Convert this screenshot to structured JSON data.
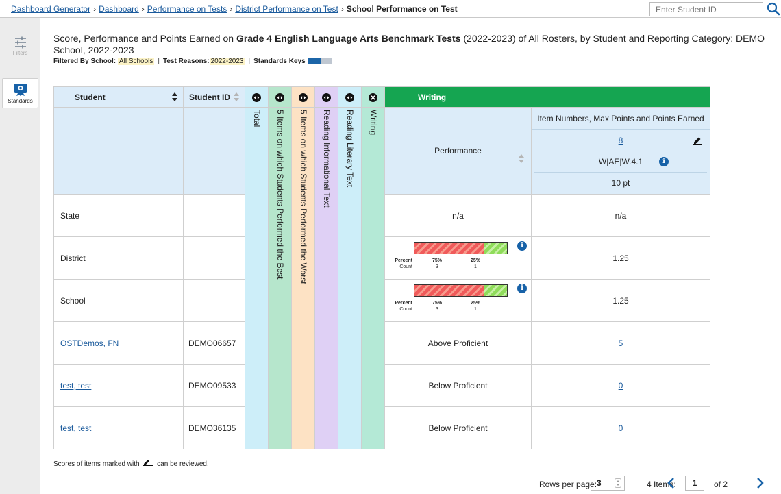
{
  "breadcrumb": [
    {
      "label": "Dashboard Generator"
    },
    {
      "label": "Dashboard"
    },
    {
      "label": "Performance on Tests"
    },
    {
      "label": "District Performance on Test"
    }
  ],
  "breadcrumb_current": "School Performance on Test",
  "student_search": {
    "placeholder": "Enter Student ID"
  },
  "sidebar": {
    "filters_label": "Filters",
    "standards_label": "Standards"
  },
  "description": {
    "prefix": "Score, Performance and Points Earned on ",
    "bold": "Grade 4 English Language Arts Benchmark Tests",
    "suffix": " (2022-2023) of All Rosters, by Student and Reporting Category: DEMO School, 2022-2023"
  },
  "filters": {
    "label": "Filtered By",
    "school_key": "School:",
    "school_value": "All Schools",
    "reasons_key": "Test Reasons:",
    "reasons_value": "2022-2023",
    "keys_label": "Standards Keys"
  },
  "table": {
    "col_student": "Student",
    "col_student_id": "Student ID",
    "vertical_cols": [
      {
        "label": "Total",
        "color": "#cdeef9"
      },
      {
        "label": "5 Items on which Students Performed the Best",
        "color": "#b6e6cc"
      },
      {
        "label": "5 Items on which Students Performed the Worst",
        "color": "#fde2c4"
      },
      {
        "label": "Reading Informational Text",
        "color": "#dfd0f5"
      },
      {
        "label": "Reading Literary Text",
        "color": "#cdeef9"
      },
      {
        "label": "Writing",
        "color": "#b4e9d6"
      }
    ],
    "writing_header": "Writing",
    "performance_header": "Performance",
    "items_header": "Item Numbers, Max Points and Points Earned",
    "item_number": "8",
    "item_standard": "W|AE|W.4.1",
    "item_max_points": "10 pt",
    "rows": [
      {
        "student": "State",
        "id": "",
        "performance": "n/a",
        "points": "n/a"
      },
      {
        "student": "District",
        "id": "",
        "bar": {
          "percent_label": "Percent",
          "count_label": "Count",
          "below_pct": "75%",
          "above_pct": "25%",
          "below_count": "3",
          "above_count": "1",
          "below_fraction": 0.75
        },
        "points": "1.25"
      },
      {
        "student": "School",
        "id": "",
        "bar": {
          "percent_label": "Percent",
          "count_label": "Count",
          "below_pct": "75%",
          "above_pct": "25%",
          "below_count": "3",
          "above_count": "1",
          "below_fraction": 0.75
        },
        "points": "1.25"
      },
      {
        "student": "OSTDemos, FN",
        "id": "DEMO06657",
        "performance": "Above Proficient",
        "points": "5"
      },
      {
        "student": "test, test",
        "id": "DEMO09533",
        "performance": "Below Proficient",
        "points": "0"
      },
      {
        "student": "test, test",
        "id": "DEMO36135",
        "performance": "Below Proficient",
        "points": "0"
      }
    ]
  },
  "footnote": {
    "before": "Scores of items marked with",
    "after": "can be reviewed."
  },
  "pagination": {
    "rows_per_page_label": "Rows per page:",
    "rows_per_page": "3",
    "items_label": "4 Items:",
    "page": "1",
    "of_pages": "of 2"
  },
  "colors": {
    "accent": "#1762a8",
    "writing_header": "#15a551",
    "header_bg": "#dcecf9",
    "below": "#f05a5a",
    "above": "#8fdc5a"
  }
}
